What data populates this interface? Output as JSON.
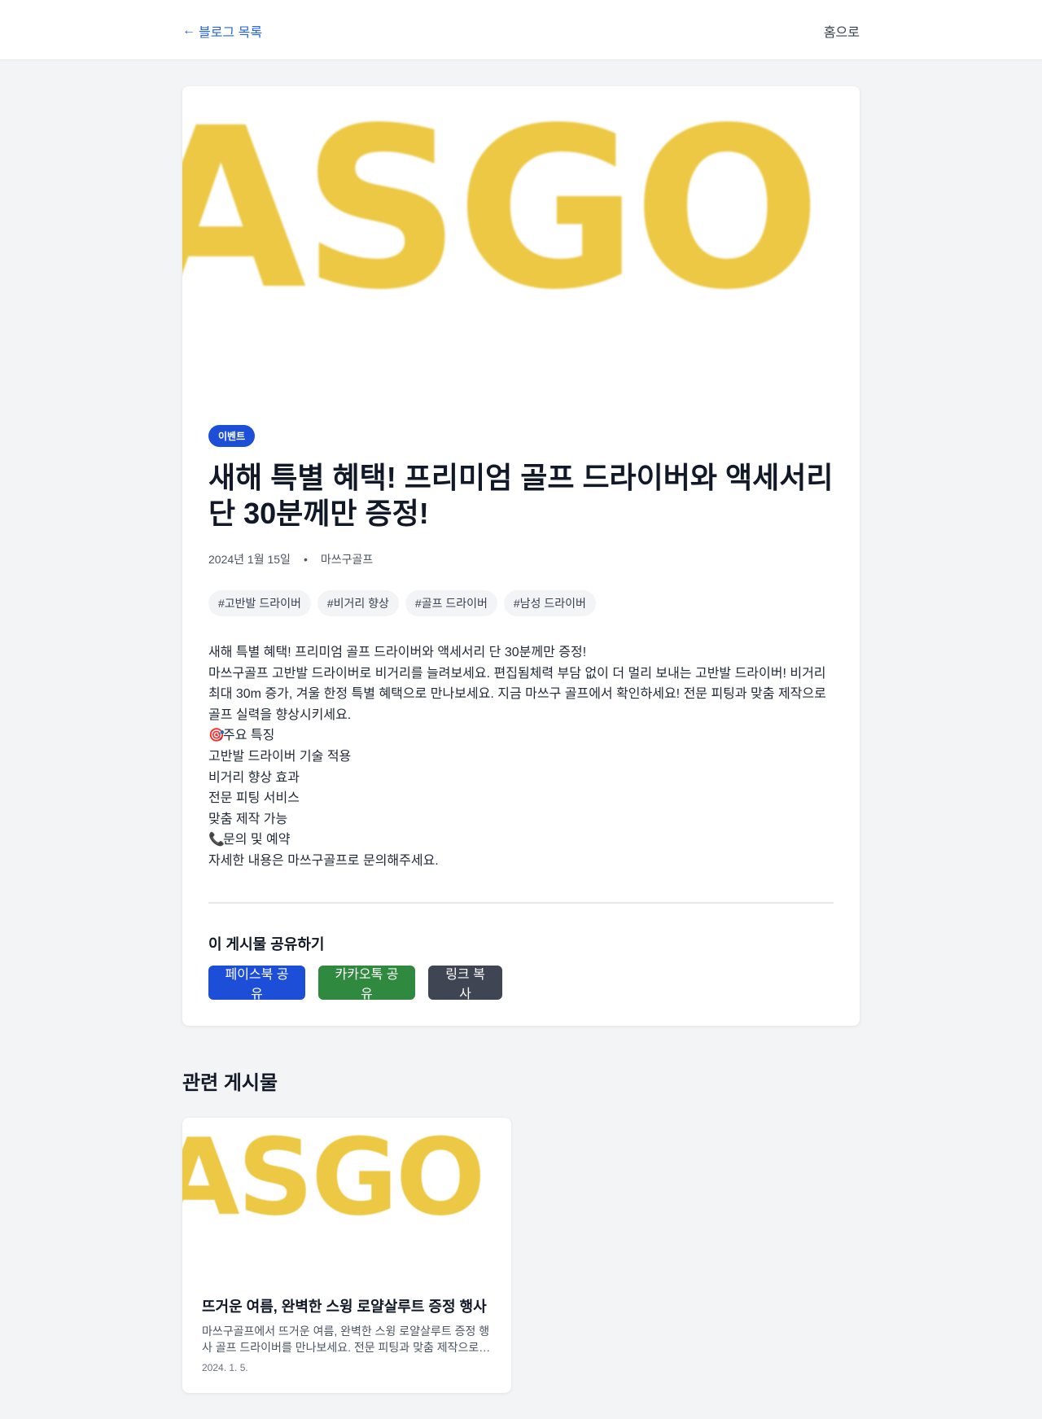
{
  "nav": {
    "back_arrow": "←",
    "back_label": "블로그 목록",
    "home_label": "홈으로"
  },
  "article": {
    "hero_logo_text": "ASGO",
    "category": "이벤트",
    "title": "새해 특별 혜택! 프리미엄 골프 드라이버와 액세서리 단 30분께만 증정!",
    "date": "2024년 1월 15일",
    "separator": "•",
    "author": "마쓰구골프",
    "tags": [
      "#고반발 드라이버",
      "#비거리 향상",
      "#골프 드라이버",
      "#남성 드라이버"
    ],
    "content": {
      "line1": "새해 특별 혜택! 프리미엄 골프 드라이버와 액세서리 단 30분께만 증정!",
      "line2": "마쓰구골프 고반발 드라이버로 비거리를 늘려보세요. 편집됨체력 부담 없이 더 멀리 보내는 고반발 드라이버! 비거리 최대 30m 증가, 겨울 한정 특별 혜택으로 만나보세요. 지금 마쓰구 골프에서 확인하세요! 전문 피팅과 맞춤 제작으로 골프 실력을 향상시키세요.",
      "features_emoji": "🎯",
      "features_heading": "주요 특징",
      "features": [
        "고반발 드라이버 기술 적용",
        "비거리 향상 효과",
        "전문 피팅 서비스",
        "맞춤 제작 가능"
      ],
      "contact_emoji": "📞",
      "contact_heading": "문의 및 예약",
      "contact_text": "자세한 내용은 마쓰구골프로 문의해주세요."
    }
  },
  "share": {
    "title": "이 게시물 공유하기",
    "facebook_label": "페이스북 공유",
    "kakao_label": "카카오톡 공유",
    "copy_label": "링크 복사"
  },
  "related": {
    "heading": "관련 게시물",
    "posts": [
      {
        "logo_text": "ASGO",
        "title": "뜨거운 여름, 완벽한 스윙 로얄살루트 증정 행사",
        "excerpt": "마쓰구골프에서 뜨거운 여름, 완벽한 스윙 로얄살루트 증정 행사 골프 드라이버를 만나보세요. 전문 피팅과 맞춤 제작으로 골프 ...",
        "date": "2024. 1. 5."
      }
    ]
  },
  "colors": {
    "accent": "#2563eb",
    "badge": "#1d4ed8",
    "kakao": "#2f8a3f",
    "copy": "#3f4552",
    "logo_yellow": "#ecc844",
    "background": "#f3f4f6"
  }
}
